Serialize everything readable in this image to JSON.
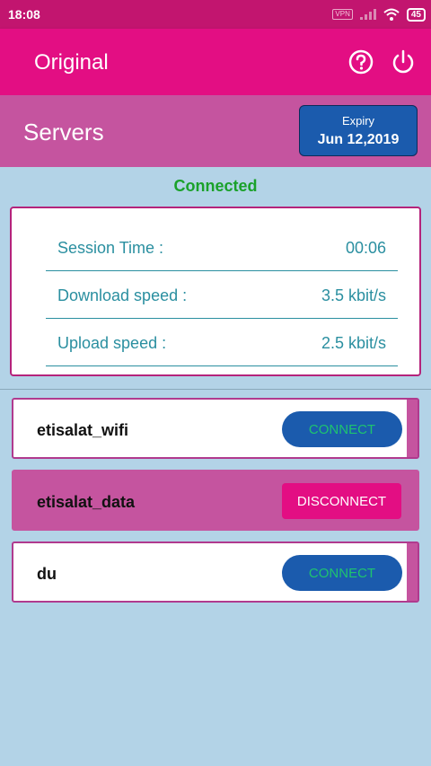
{
  "status_bar": {
    "time": "18:08",
    "vpn": "VPN",
    "battery": "45"
  },
  "header": {
    "title": "Original",
    "help_icon": "help-circle-icon",
    "power_icon": "power-icon"
  },
  "servers_bar": {
    "label": "Servers",
    "expiry_label": "Expiry",
    "expiry_date": "Jun 12,2019"
  },
  "status": {
    "text": "Connected",
    "color": "#1aa12a"
  },
  "stats": [
    {
      "label": "Session Time :",
      "value": "00:06"
    },
    {
      "label": "Download speed :",
      "value": "3.5 kbit/s"
    },
    {
      "label": "Upload speed :",
      "value": "2.5 kbit/s"
    }
  ],
  "servers": [
    {
      "name": "etisalat_wifi",
      "button": "CONNECT",
      "active": false
    },
    {
      "name": "etisalat_data",
      "button": "DISCONNECT",
      "active": true
    },
    {
      "name": "du",
      "button": "CONNECT",
      "active": false
    }
  ],
  "colors": {
    "primary": "#e30e83",
    "secondary": "#c5549f",
    "accent_blue": "#1b5bad",
    "background": "#b3d3e7"
  }
}
